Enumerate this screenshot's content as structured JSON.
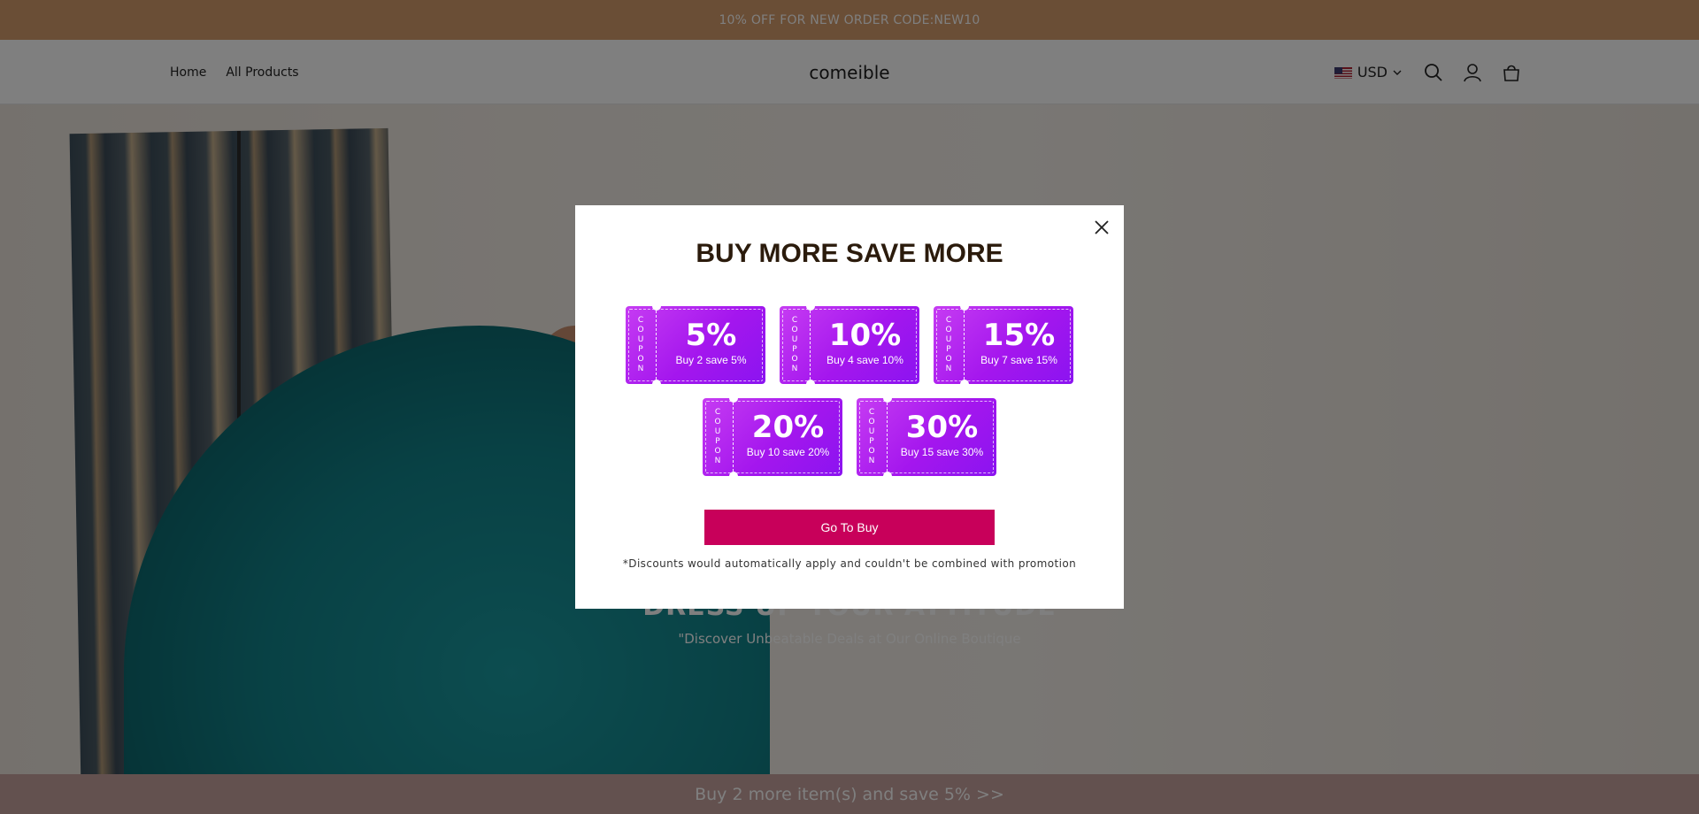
{
  "announcement": {
    "text": "10% OFF FOR NEW ORDER CODE:NEW10"
  },
  "header": {
    "nav": [
      {
        "label": "Home"
      },
      {
        "label": "All Products"
      }
    ],
    "logo": "comeible",
    "currency": {
      "code": "USD",
      "flag": "us-flag-icon"
    },
    "icons": [
      "search-icon",
      "account-icon",
      "cart-icon"
    ]
  },
  "hero": {
    "title": "DRESS UP YOUR ATTITUDE",
    "subtitle": "\"Discover Unbeatable Deals at Our Online Boutique"
  },
  "popup": {
    "title": "BUY MORE SAVE MORE",
    "coupon_stub": "COUPON",
    "coupons": [
      {
        "percent": "5%",
        "desc": "Buy 2 save 5%"
      },
      {
        "percent": "10%",
        "desc": "Buy 4 save 10%"
      },
      {
        "percent": "15%",
        "desc": "Buy 7 save 15%"
      },
      {
        "percent": "20%",
        "desc": "Buy 10 save 20%"
      },
      {
        "percent": "30%",
        "desc": "Buy 15 save 30%"
      }
    ],
    "button_label": "Go To Buy",
    "disclaimer": "*Discounts would automatically apply and couldn't be combined with promotion"
  },
  "bottom_bar": {
    "text": "Buy 2 more item(s) and save 5%  >>"
  },
  "colors": {
    "announcement_bg": "#d59c6c",
    "coupon_gradient_start": "#c63cf2",
    "coupon_gradient_end": "#8b14f0",
    "button_bg": "#c8005a",
    "bottom_bar_bg": "#c7a39f"
  }
}
